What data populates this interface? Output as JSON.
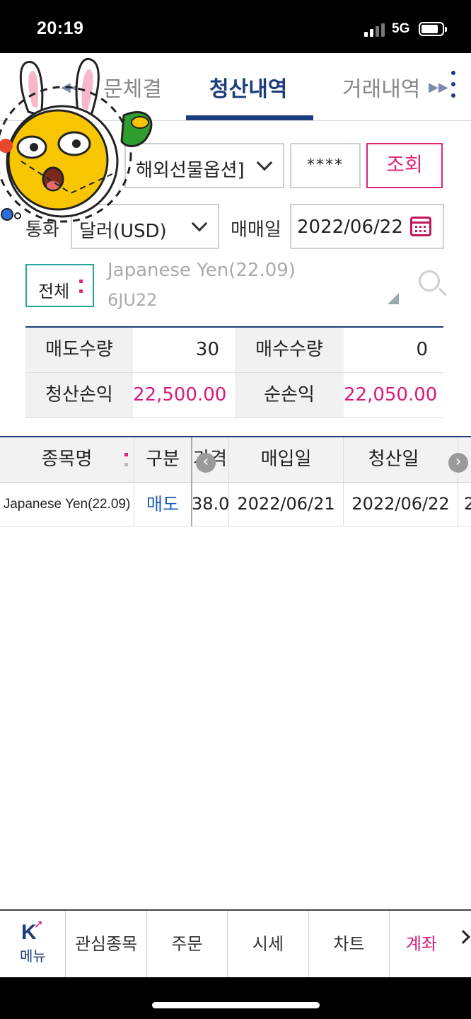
{
  "status_bar": {
    "time": "20:19",
    "network": "5G"
  },
  "tabs": {
    "prev": "문체결",
    "active": "청산내역",
    "next": "거래내역"
  },
  "filters": {
    "account_type": "해외선물옵션]",
    "password_mask": "****",
    "search_button": "조회",
    "currency_label": "통화",
    "currency_value": "달러(USD)",
    "trade_date_label": "매매일",
    "trade_date_value": "2022/06/22",
    "all_button": "전체",
    "symbol_name": "Japanese Yen(22.09)",
    "symbol_code": "6JU22"
  },
  "summary": {
    "sell_qty_label": "매도수량",
    "sell_qty": "30",
    "buy_qty_label": "매수수량",
    "buy_qty": "0",
    "liq_pnl_label": "청산손익",
    "liq_pnl": "22,500.00",
    "net_pnl_label": "순손익",
    "net_pnl": "22,050.00"
  },
  "table": {
    "headers": {
      "name": "종목명",
      "side": "구분",
      "price_partial": "가격",
      "buy_date": "매입일",
      "liq_date": "청산일"
    },
    "rows": [
      {
        "name": "Japanese Yen(22.09)",
        "side": "매도",
        "price_partial": "38.0",
        "buy_date": "2022/06/21",
        "liq_date": "2022/06/22",
        "overflow": "2"
      }
    ]
  },
  "bottom_nav": {
    "menu": "메뉴",
    "watchlist": "관심종목",
    "order": "주문",
    "quote": "시세",
    "chart": "차트",
    "account": "계좌"
  },
  "colors": {
    "navy": "#1b3d7b",
    "pink": "#d81b7a",
    "teal": "#26a69a"
  }
}
